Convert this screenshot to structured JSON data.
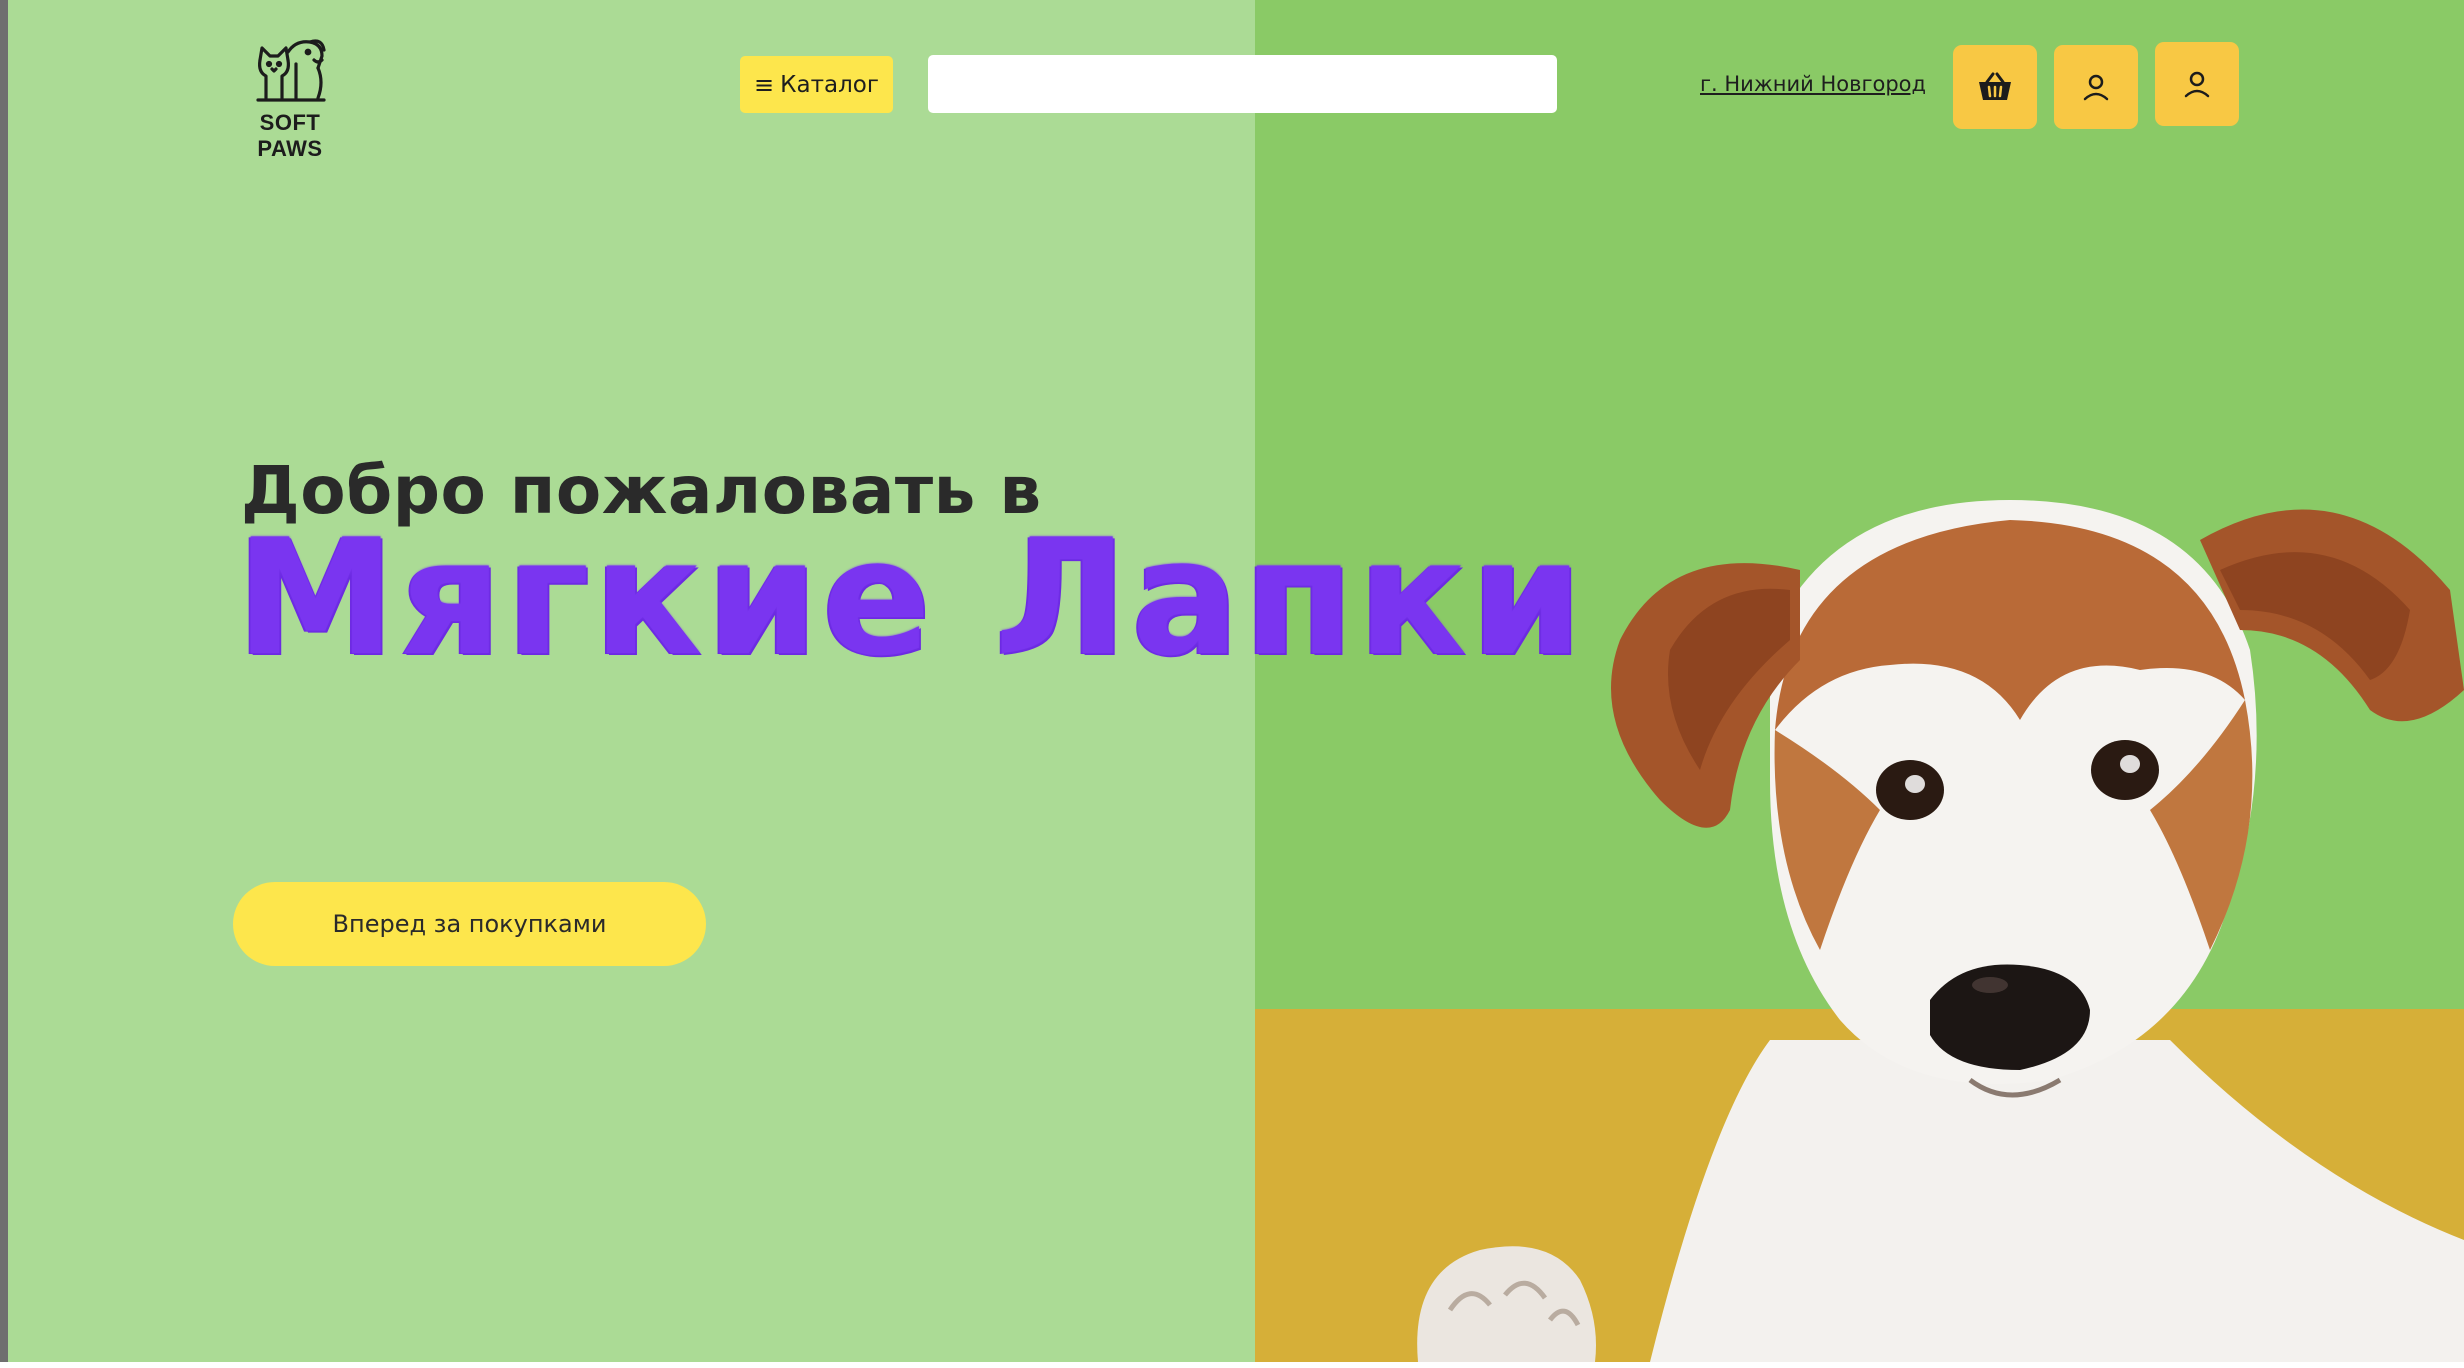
{
  "colors": {
    "left_bg": "#abdb95",
    "right_bg_top": "#8aca66",
    "right_bg_bottom": "#d6af38",
    "accent_yellow": "#fde64c",
    "button_orange": "#f8c844",
    "brand_purple": "#7a35f0",
    "text_dark": "#2a2a2a"
  },
  "header": {
    "logo_text": "SOFT PAWS",
    "catalog_label": "Каталог",
    "catalog_icon": "burger-menu-icon",
    "search_placeholder": "",
    "search_value": "",
    "city_label": "г. Нижний Новгород",
    "icon_buttons": [
      "basket-icon",
      "user-icon",
      "user-icon"
    ]
  },
  "hero": {
    "greeting": "Добро пожаловать в",
    "brand": "Мягкие Лапки",
    "cta_label": "Вперед за покупками"
  },
  "images": {
    "logo": "cat-and-dog-logo",
    "hero": "jack-russell-terrier-dog-photo"
  }
}
